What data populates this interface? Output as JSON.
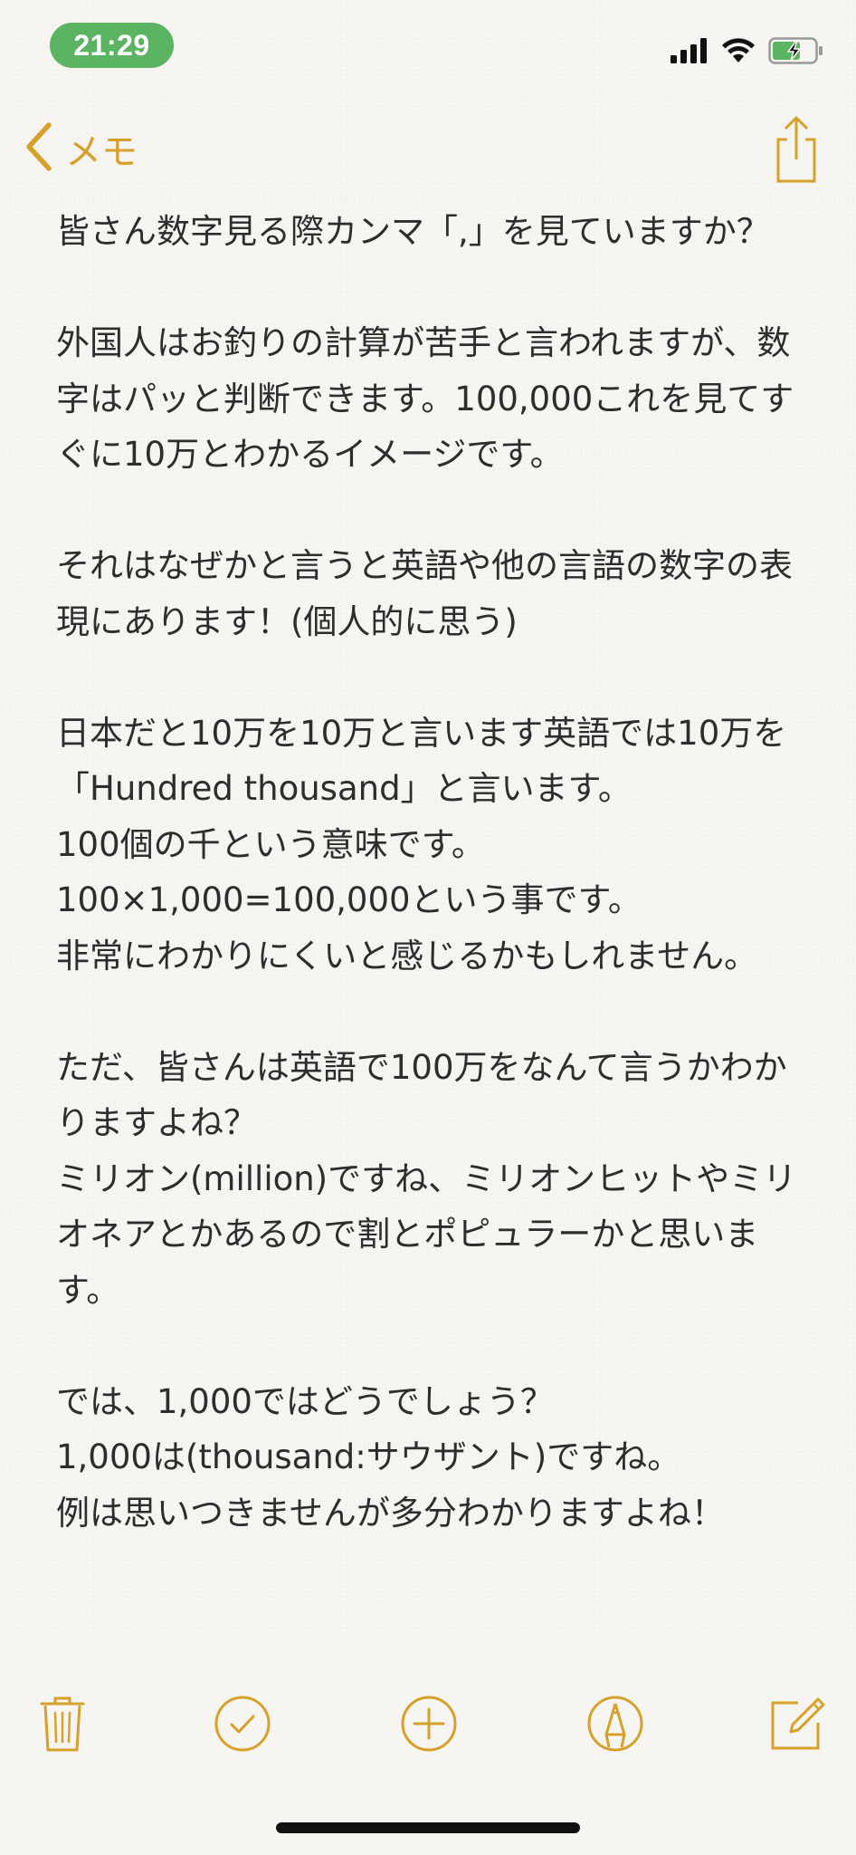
{
  "status_bar": {
    "time": "21:29",
    "icons": [
      "cellular-signal-icon",
      "wifi-icon",
      "battery-charging-icon"
    ],
    "accent_color": "#5bb462"
  },
  "nav": {
    "back_label": "メモ",
    "accent_color": "#d6a02a",
    "icons": [
      "chevron-left-icon",
      "share-icon"
    ]
  },
  "note": {
    "lines": [
      "皆さん数字見る際カンマ「,」を見ていますか？",
      "",
      "外国人はお釣りの計算が苦手と言われますが、数字はパッと判断できます。100,000これを見てすぐに10万とわかるイメージです。",
      "",
      "それはなぜかと言うと英語や他の言語の数字の表現にあります！(個人的に思う)",
      "",
      "日本だと10万を10万と言います英語では10万を「Hundred thousand」と言います。",
      "100個の千という意味です。",
      "100×1,000=100,000という事です。",
      "非常にわかりにくいと感じるかもしれません。",
      "",
      "ただ、皆さんは英語で100万をなんて言うかわかりますよね？",
      "ミリオン(million)ですね、ミリオンヒットやミリオネアとかあるので割とポピュラーかと思います。",
      "",
      "では、1,000ではどうでしょう？",
      "1,000は(thousand:サウザント)ですね。",
      "例は思いつきませんが多分わかりますよね！"
    ]
  },
  "toolbar": {
    "icons": [
      "trash-icon",
      "checklist-icon",
      "add-icon",
      "markup-icon",
      "compose-icon"
    ]
  }
}
